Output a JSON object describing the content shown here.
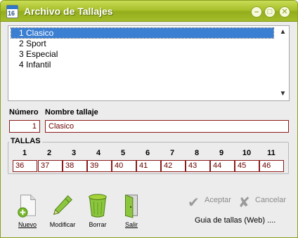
{
  "window": {
    "title": "Archivo de Tallajes",
    "icon_text": "16",
    "controls": {
      "minimize": "–",
      "maximize": "□",
      "close": "✕"
    }
  },
  "list": {
    "items": [
      {
        "label": "1 Clasico",
        "selected": true
      },
      {
        "label": "2 Sport",
        "selected": false
      },
      {
        "label": "3 Especial",
        "selected": false
      },
      {
        "label": "4 Infantil",
        "selected": false
      }
    ],
    "scroll_up": "▲",
    "scroll_down": "▼"
  },
  "form": {
    "numero_label": "Número",
    "nombre_label": "Nombre tallaje",
    "numero_value": "1",
    "nombre_value": "Clasico"
  },
  "tallas": {
    "title": "TALLAS",
    "columns": [
      {
        "num": "1",
        "value": "36"
      },
      {
        "num": "2",
        "value": "37"
      },
      {
        "num": "3",
        "value": "38"
      },
      {
        "num": "4",
        "value": "39"
      },
      {
        "num": "5",
        "value": "40"
      },
      {
        "num": "6",
        "value": "41"
      },
      {
        "num": "7",
        "value": "42"
      },
      {
        "num": "8",
        "value": "43"
      },
      {
        "num": "9",
        "value": "44"
      },
      {
        "num": "10",
        "value": "45"
      },
      {
        "num": "11",
        "value": "46"
      }
    ]
  },
  "toolbar": {
    "nuevo": "Nuevo",
    "modificar": "Modificar",
    "borrar": "Borrar",
    "salir": "Salir"
  },
  "actions": {
    "aceptar": "Aceptar",
    "cancelar": "Cancelar",
    "aceptar_icon": "✔",
    "cancelar_icon": "✘"
  },
  "guide_link": "Guia de tallas (Web) ....",
  "colors": {
    "title_bar": "#a8c12b",
    "selection": "#3b7fd3",
    "field_border": "#8b1a1a"
  }
}
